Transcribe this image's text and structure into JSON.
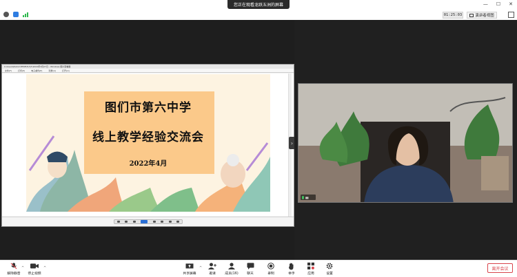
{
  "top_bar": {
    "sharing_banner": "您正在观看龙跃五洲的屏幕",
    "timer": "01:25:03",
    "view_label": "演讲者视图"
  },
  "shared_window": {
    "title": "C:\\Users\\Public\\TEMP\\TLFJ7\\2022年3月27日 - Windows 照片查看器",
    "menu": [
      "文件(F)",
      "打印(P)",
      "电子邮件(E)",
      "刻录(U)",
      "打开(O)"
    ]
  },
  "slide": {
    "line1": "图们市第六中学",
    "line2": "线上教学经验交流会",
    "line3": "2022年4月"
  },
  "toolbar": {
    "mute": "解除静音",
    "stop_video": "停止视频",
    "share_screen": "共享屏幕",
    "invite": "邀请",
    "members": "成员(16)",
    "chat": "聊天",
    "record": "录制",
    "raise_hand": "举手",
    "apps": "应用",
    "settings": "设置",
    "leave": "离开会议"
  },
  "colors": {
    "accent_red": "#d8434a",
    "slide_bg": "#fdf3e1",
    "slide_box": "#fbc98a"
  }
}
